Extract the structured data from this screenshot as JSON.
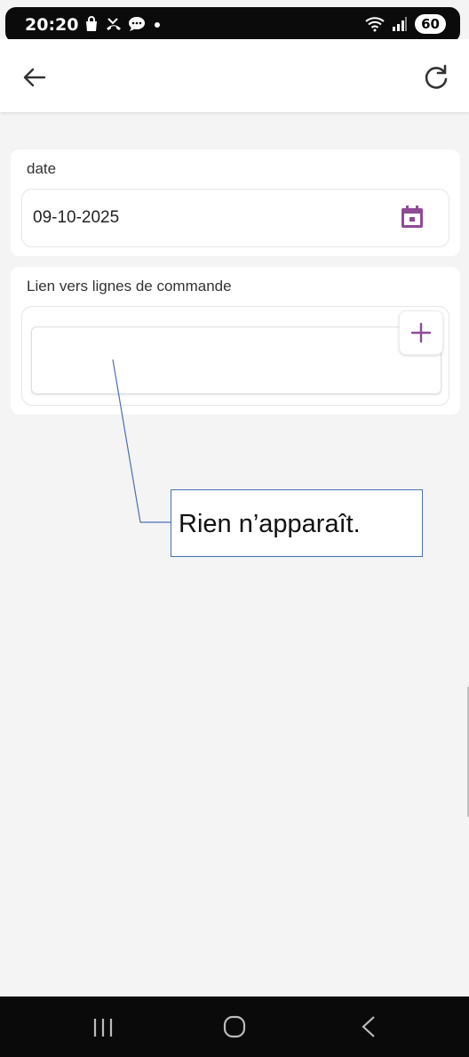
{
  "status_bar": {
    "time": "20:20",
    "left_icons": [
      "shopping-bag-icon",
      "missed-call-icon",
      "message-icon",
      "dot-icon"
    ],
    "right_icons": [
      "wifi-icon",
      "signal-icon"
    ],
    "battery": "60"
  },
  "app_bar": {
    "back_icon": "arrow-left-icon",
    "refresh_icon": "refresh-icon"
  },
  "form": {
    "date": {
      "label": "date",
      "value": "09-10-2025",
      "icon": "calendar-icon"
    },
    "lien": {
      "label": "Lien vers lignes de commande",
      "value": "",
      "add_icon": "plus-icon"
    }
  },
  "annotation": {
    "text": "Rien n’apparaît."
  },
  "nav_bar": {
    "items": [
      "recent-apps-icon",
      "home-icon",
      "back-icon"
    ]
  },
  "colors": {
    "accent": "#8e4b96",
    "annotation_border": "#4a6fb3"
  }
}
